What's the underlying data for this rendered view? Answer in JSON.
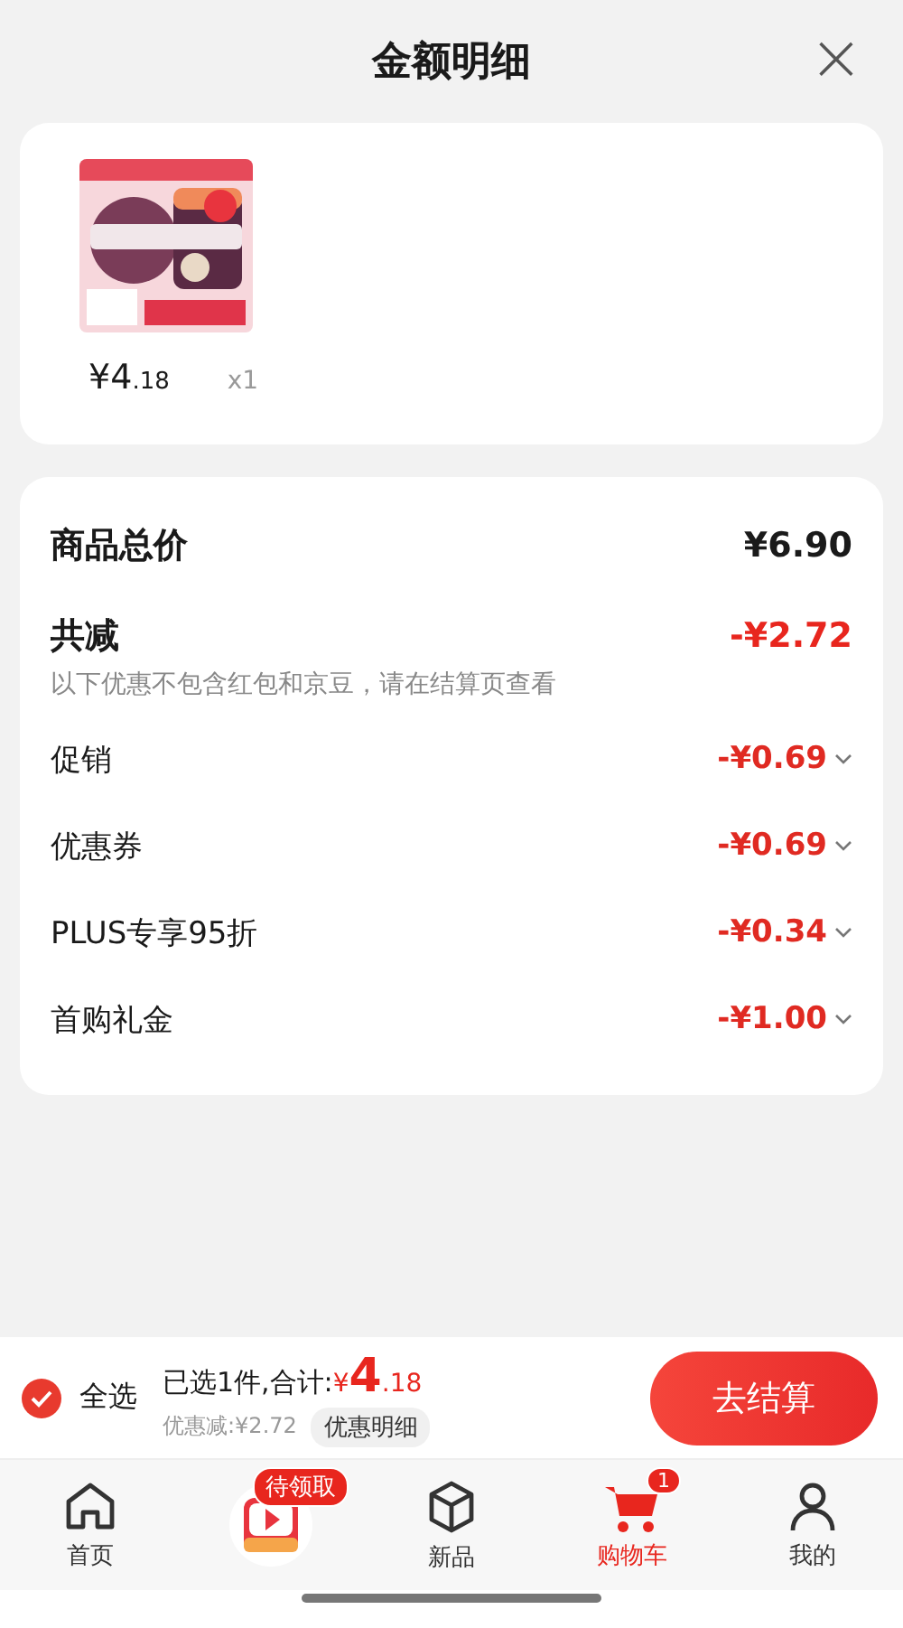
{
  "header": {
    "title": "金额明细",
    "close": "×"
  },
  "product": {
    "kind": "picture",
    "price": {
      "currency": "¥",
      "integer": "4",
      "decimal": ".18"
    },
    "quantity": "x1"
  },
  "summary": {
    "total": {
      "label": "商品总价",
      "value": "¥6.90"
    },
    "reduction": {
      "label": "共减",
      "value": "-¥2.72",
      "note": "以下优惠不包含红包和京豆，请在结算页查看"
    },
    "items": [
      {
        "label": "促销",
        "value": "-¥0.69",
        "expanded": false
      },
      {
        "label": "优惠券",
        "value": "-¥0.69",
        "expanded": false
      },
      {
        "label": "PLUS专享95折",
        "value": "-¥0.34",
        "expanded": false
      },
      {
        "label": "首购礼金",
        "value": "-¥1.00",
        "expanded": false
      }
    ]
  },
  "checkout": {
    "select_all": {
      "label": "全选",
      "checked": true
    },
    "selected_text": "已选1件,合计:",
    "total": {
      "currency": "¥",
      "integer": "4",
      "decimal": ".18"
    },
    "discount": "优惠减:¥2.72",
    "detail_button": "优惠明细",
    "pay_button": "去结算"
  },
  "tabbar": [
    {
      "kind": "home",
      "label": "首页",
      "selected": false
    },
    {
      "kind": "promo",
      "badge": "待领取",
      "selected": false
    },
    {
      "kind": "box",
      "label": "新品",
      "selected": false
    },
    {
      "kind": "cart",
      "label": "购物车",
      "badge": "1",
      "selected": true
    },
    {
      "kind": "user",
      "label": "我的",
      "selected": false
    }
  ]
}
